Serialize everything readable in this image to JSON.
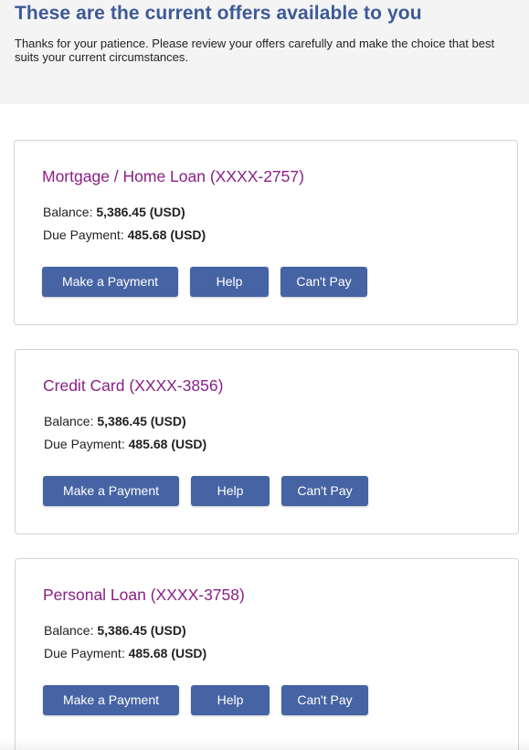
{
  "header": {
    "title": "These are the current offers available to you",
    "text": "Thanks for your patience. Please review your offers carefully and make the choice that best suits your current circumstances."
  },
  "accounts": [
    {
      "title": "Mortgage / Home Loan (XXXX-2757)",
      "balance_label": "Balance:",
      "balance_value": "5,386.45 (USD)",
      "due_label": "Due Payment:",
      "due_value": "485.68 (USD)",
      "pay_label": "Make a Payment",
      "help_label": "Help",
      "cant_pay_label": "Can't Pay"
    },
    {
      "title": "Credit Card (XXXX-3856)",
      "balance_label": "Balance:",
      "balance_value": "5,386.45 (USD)",
      "due_label": "Due Payment:",
      "due_value": "485.68 (USD)",
      "pay_label": "Make a Payment",
      "help_label": "Help",
      "cant_pay_label": "Can't Pay"
    },
    {
      "title": "Personal Loan (XXXX-3758)",
      "balance_label": "Balance:",
      "balance_value": "5,386.45 (USD)",
      "due_label": "Due Payment:",
      "due_value": "485.68 (USD)",
      "pay_label": "Make a Payment",
      "help_label": "Help",
      "cant_pay_label": "Can't Pay"
    }
  ],
  "colors": {
    "header_bg": "#f4f4f4",
    "title": "#3d5a98",
    "card_title": "#8a1f86",
    "button": "#4664a3",
    "button_text": "#ffffff"
  }
}
